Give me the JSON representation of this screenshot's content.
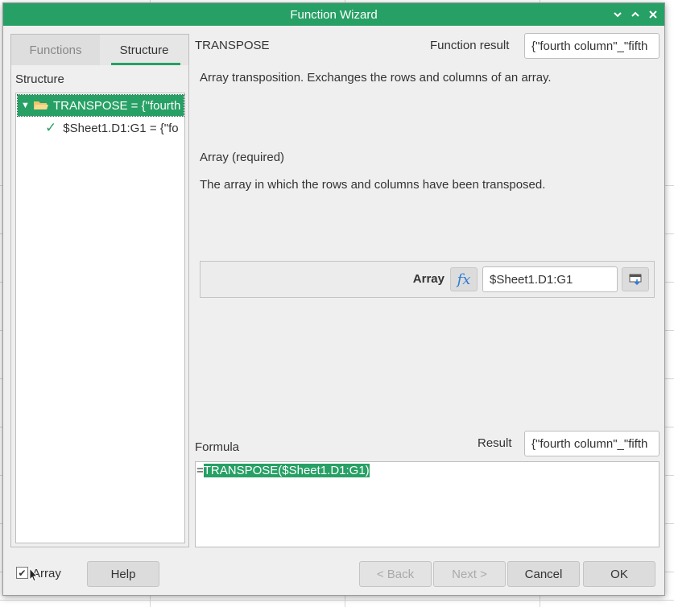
{
  "window": {
    "title": "Function Wizard"
  },
  "tabs": {
    "functions": "Functions",
    "structure": "Structure"
  },
  "structure_label": "Structure",
  "tree": {
    "root_label": "TRANSPOSE = {\"fourth",
    "child_label": "$Sheet1.D1:G1 = {\"fo"
  },
  "function": {
    "name": "TRANSPOSE",
    "result_label": "Function result",
    "result_value": "{\"fourth column\"_\"fifth",
    "description": "Array transposition. Exchanges the rows and columns of an array."
  },
  "argument": {
    "required_label": "Array (required)",
    "description": "The array in which the rows and columns have been transposed.",
    "name": "Array",
    "fx_label": "fx",
    "value": "$Sheet1.D1:G1"
  },
  "formula": {
    "label": "Formula",
    "result_label": "Result",
    "result_value": "{\"fourth column\"_\"fifth",
    "prefix": "=",
    "selected_text": "TRANSPOSE($Sheet1.D1:G1)"
  },
  "bottom": {
    "array_checkbox_label": "Array",
    "array_checked": true,
    "help": "Help",
    "back": "< Back",
    "next": "Next >",
    "cancel": "Cancel",
    "ok": "OK"
  },
  "colors": {
    "accent": "#27a065",
    "fx_blue": "#2b7bd6"
  }
}
